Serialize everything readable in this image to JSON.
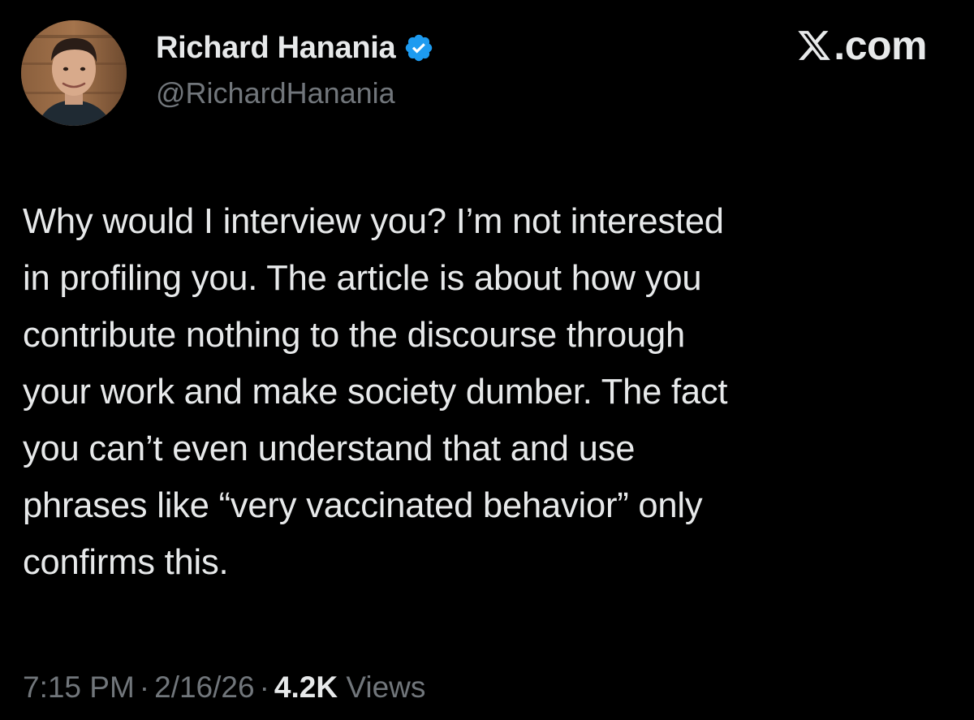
{
  "author": {
    "display_name": "Richard Hanania",
    "handle": "@RichardHanania",
    "verified_icon": "verified-badge-icon",
    "verified_color": "#1d9bf0"
  },
  "site": {
    "logo_icon": "x-logo-icon",
    "domain_suffix": ".com"
  },
  "tweet": {
    "lines": [
      "Why would I interview you? I’m not interested",
      "in profiling you. The article is about how you",
      "contribute nothing to the discourse through",
      "your work and make society dumber. The fact",
      "you can’t even understand that and use",
      "phrases like “very vaccinated behavior” only",
      "confirms this."
    ]
  },
  "meta": {
    "time": "7:15 PM",
    "separator": "·",
    "date": "2/16/26",
    "views_count": "4.2K",
    "views_label": "Views"
  },
  "colors": {
    "background": "#000000",
    "primary_text": "#e7e9ea",
    "secondary_text": "#71767b"
  }
}
